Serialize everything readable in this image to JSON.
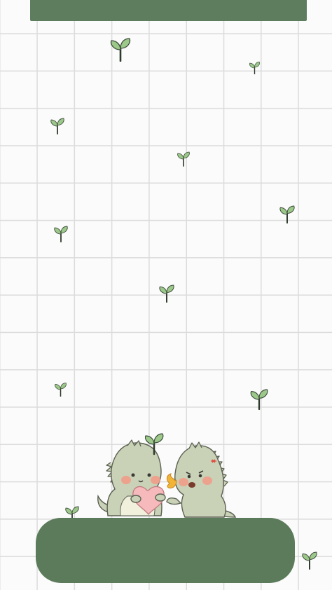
{
  "colors": {
    "banner": "#5e7d5f",
    "panel": "#5b7b5b",
    "grid_background": "#fbfbfb",
    "grid_line": "#dcdcdc",
    "leaf": "#9cc98a",
    "leaf_outline": "#3c4a3a",
    "stem": "#2e3a2c",
    "dino_body": "#c9d1b7",
    "dino_belly": "#f1f0dd",
    "dino_outline": "#5b6152",
    "cheek": "#f39a86",
    "heart": "#f6b9bc",
    "flame": "#f2b436"
  },
  "decorations": {
    "sprout_icon": "sprout-icon",
    "dino_left_icon": "dinosaur-holding-heart-icon",
    "dino_right_icon": "angry-dinosaur-breathing-fire-icon"
  }
}
